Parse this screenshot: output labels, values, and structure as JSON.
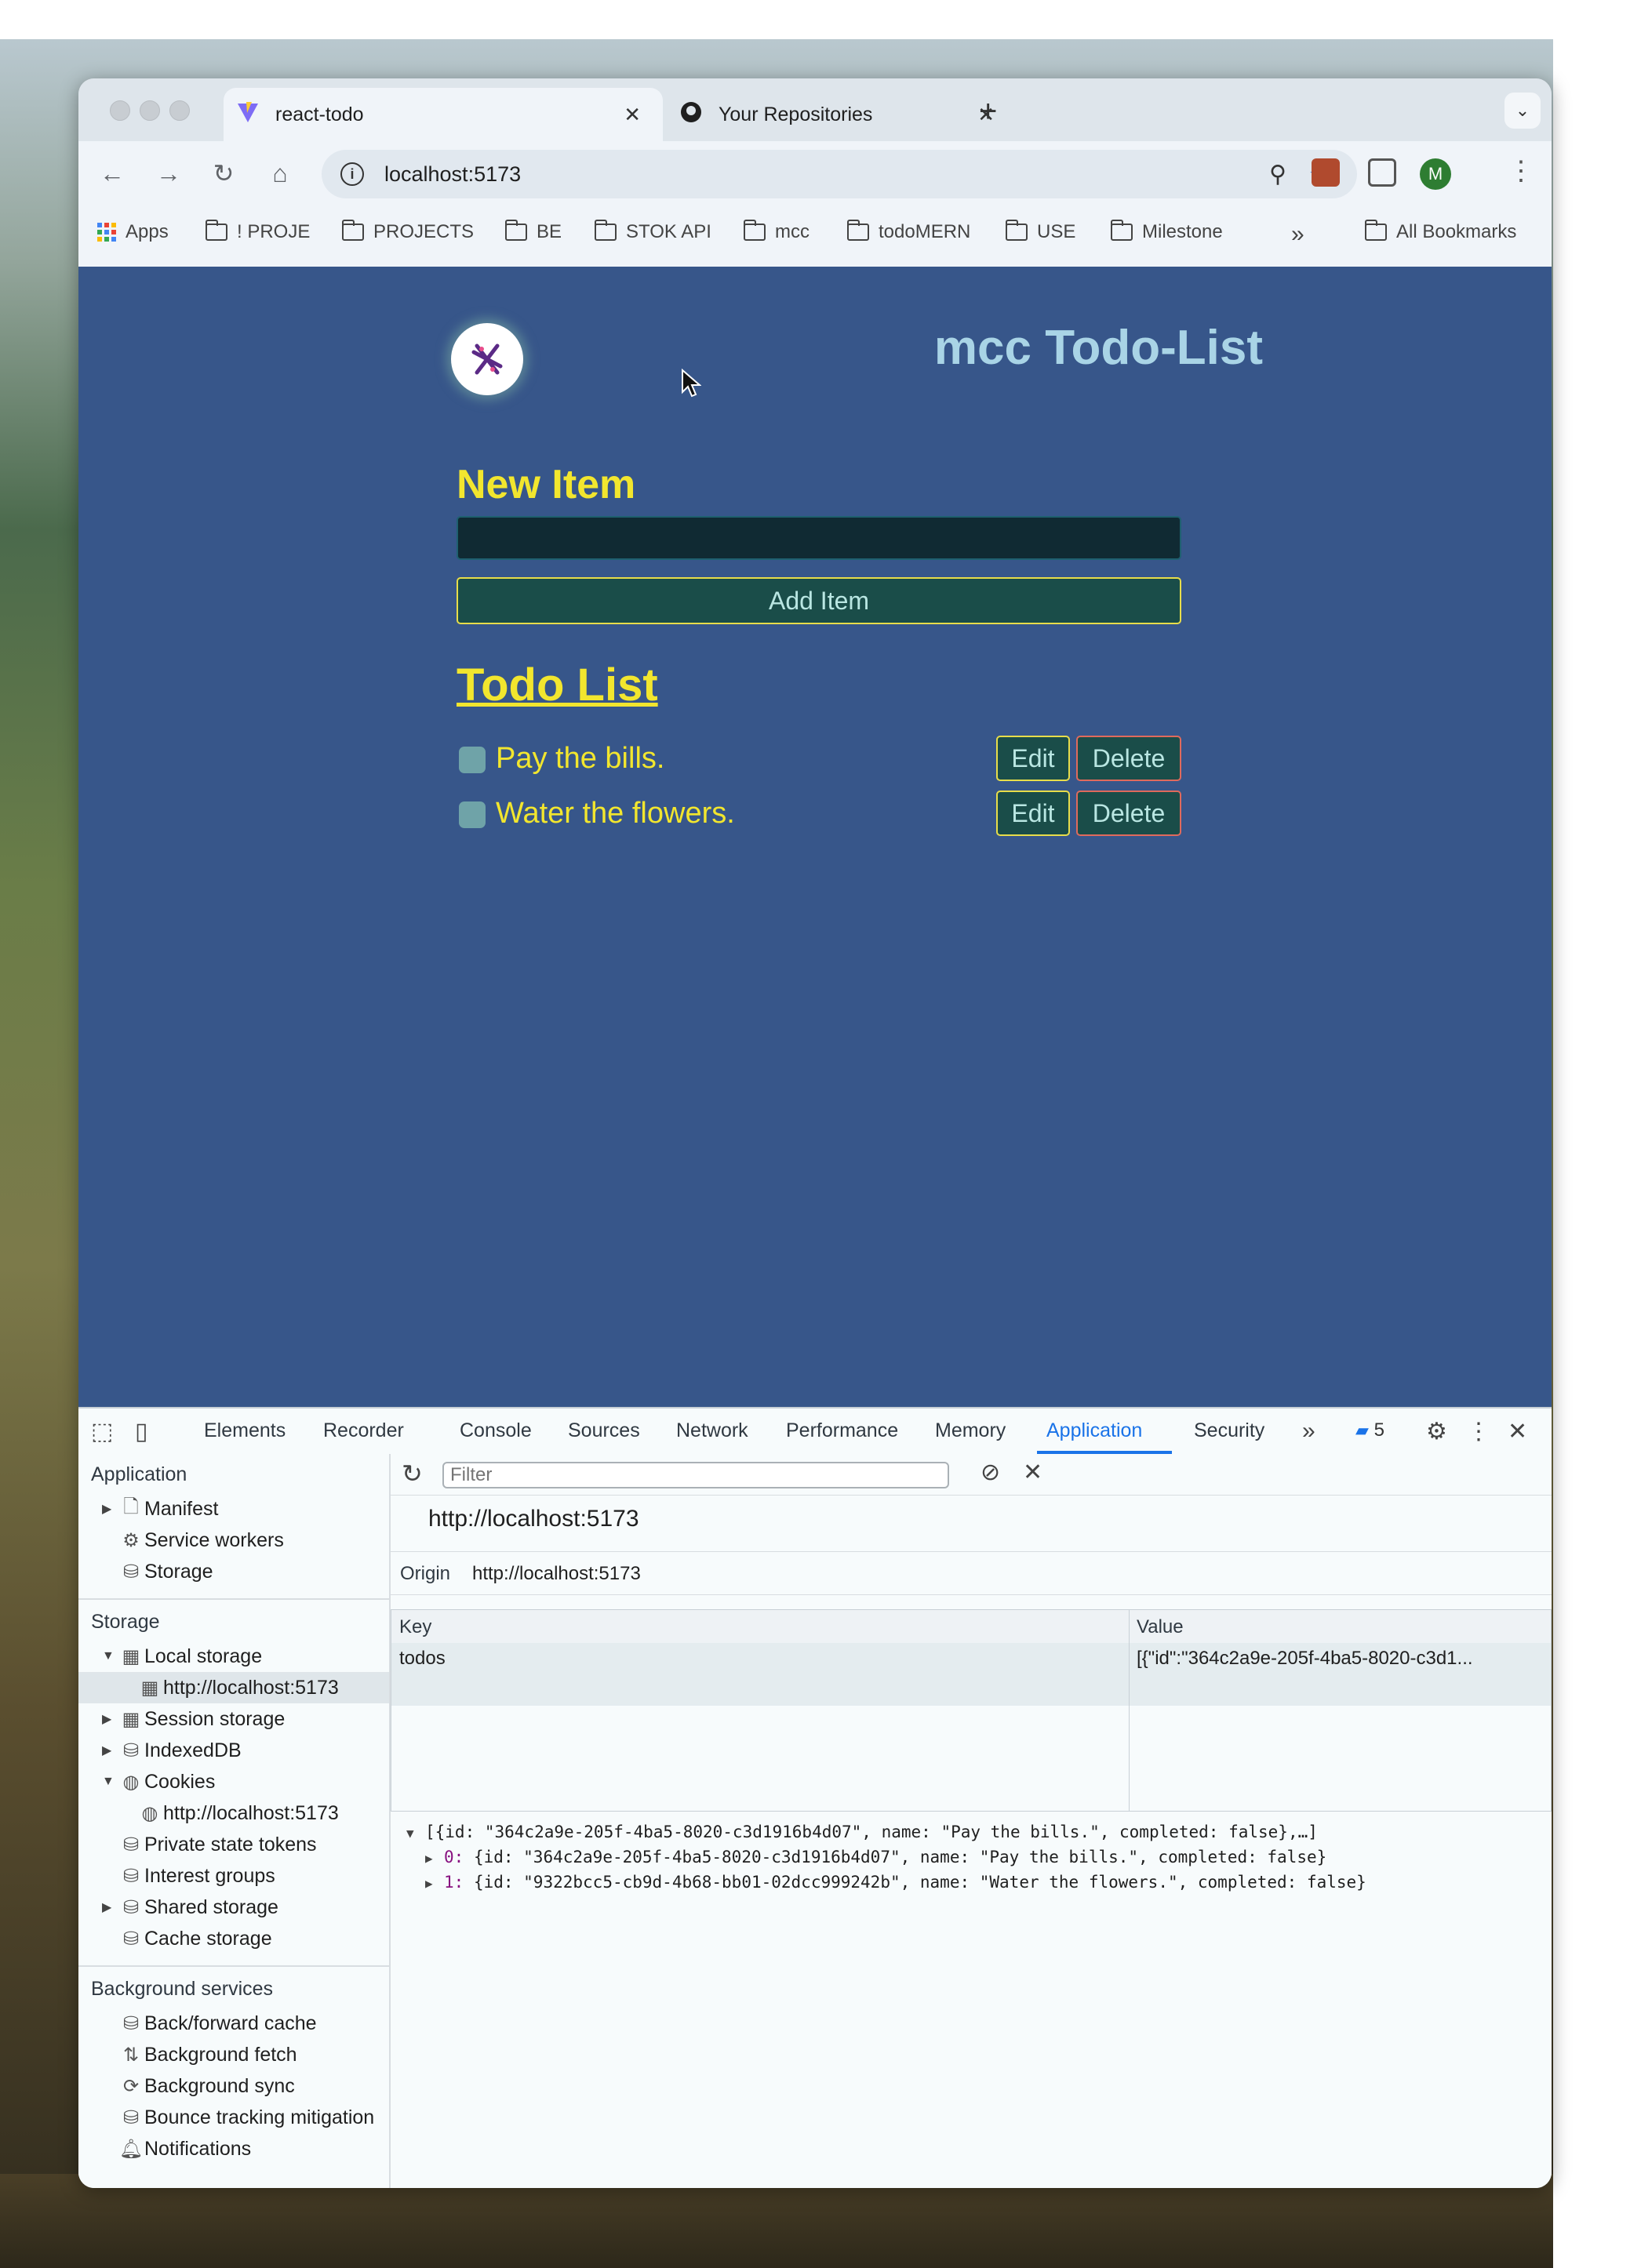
{
  "browser": {
    "tabs": [
      {
        "title": "react-todo",
        "active": true
      },
      {
        "title": "Your Repositories",
        "active": false
      }
    ],
    "address": "localhost:5173",
    "avatar_letter": "M",
    "bookmarks": [
      "Apps",
      "! PROJE",
      "PROJECTS",
      "BE",
      "STOK API",
      "mcc",
      "todoMERN",
      "USE",
      "Milestone"
    ],
    "all_bookmarks": "All Bookmarks",
    "accent": "#1a73e8"
  },
  "app": {
    "title": "mcc Todo-List",
    "new_item_label": "New Item",
    "input_value": "",
    "add_button": "Add Item",
    "list_title": "Todo List",
    "items": [
      {
        "text": "Pay the bills.",
        "completed": false
      },
      {
        "text": "Water the flowers.",
        "completed": false
      }
    ],
    "edit_label": "Edit",
    "delete_label": "Delete",
    "colors": {
      "background": "#37568a",
      "heading": "#f2e62e",
      "title": "#a9d4e6"
    }
  },
  "devtools": {
    "tabs": [
      "Elements",
      "Recorder",
      "Console",
      "Sources",
      "Network",
      "Performance",
      "Memory",
      "Application",
      "Security"
    ],
    "active_tab": "Application",
    "issues_count": "5",
    "sidebar": {
      "application_header": "Application",
      "application_items": [
        "Manifest",
        "Service workers",
        "Storage"
      ],
      "storage_header": "Storage",
      "local_storage": "Local storage",
      "local_storage_origin": "http://localhost:5173",
      "session_storage": "Session storage",
      "indexeddb": "IndexedDB",
      "cookies": "Cookies",
      "cookies_origin": "http://localhost:5173",
      "storage_items": [
        "Private state tokens",
        "Interest groups",
        "Shared storage",
        "Cache storage"
      ],
      "background_header": "Background services",
      "background_items": [
        "Back/forward cache",
        "Background fetch",
        "Background sync",
        "Bounce tracking mitigation",
        "Notifications"
      ]
    },
    "filter_placeholder": "Filter",
    "origin_header": "http://localhost:5173",
    "origin_label": "Origin",
    "origin_value": "http://localhost:5173",
    "table": {
      "key_header": "Key",
      "value_header": "Value",
      "rows": [
        {
          "key": "todos",
          "value": "[{\"id\":\"364c2a9e-205f-4ba5-8020-c3d1..."
        }
      ]
    },
    "preview": {
      "summary": "[{id: \"364c2a9e-205f-4ba5-8020-c3d1916b4d07\", name: \"Pay the bills.\", completed: false},…]",
      "items": [
        {
          "index": "0:",
          "text": "{id: \"364c2a9e-205f-4ba5-8020-c3d1916b4d07\", name: \"Pay the bills.\", completed: false}"
        },
        {
          "index": "1:",
          "text": "{id: \"9322bcc5-cb9d-4b68-bb01-02dcc999242b\", name: \"Water the flowers.\", completed: false}"
        }
      ]
    }
  }
}
